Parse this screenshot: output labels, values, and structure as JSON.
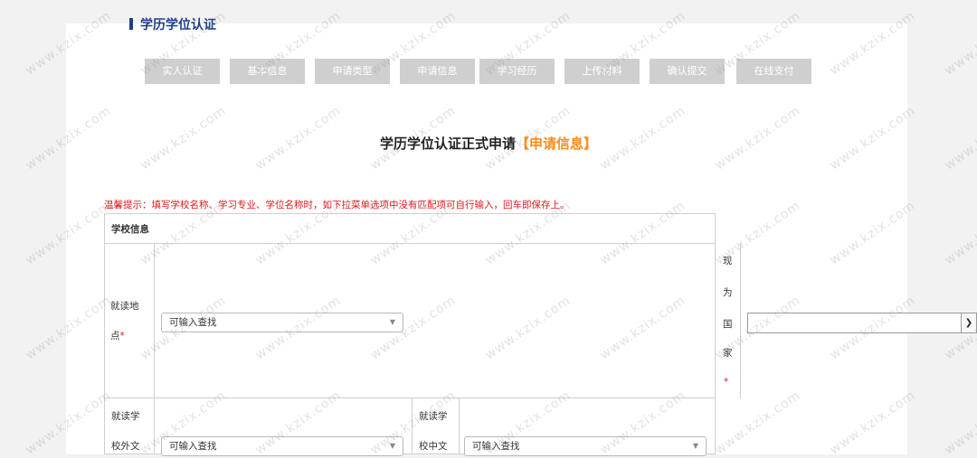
{
  "section_title": "学历学位认证",
  "steps": [
    "实人认证",
    "基本信息",
    "申请类型",
    "申请信息",
    "学习经历",
    "上传材料",
    "确认提交",
    "在线支付"
  ],
  "heading": {
    "main": "学历学位认证正式申请",
    "highlight": "【申请信息】"
  },
  "notice": "温馨提示：填写学校名称、学习专业、学位名称时，如下拉菜单选项中没有匹配项可自行输入，回车即保存上。",
  "form": {
    "section_header": "学校信息",
    "location": {
      "label_line1": "就读地",
      "label_line2": "点",
      "required": "*",
      "placeholder": "可输入查找"
    },
    "country": {
      "label_chars": [
        "现",
        "为",
        "国",
        "家"
      ],
      "required": "*",
      "value": ""
    },
    "school_foreign": {
      "label_line1": "就读学",
      "label_line2": "校外文",
      "placeholder": "可输入查找"
    },
    "school_chinese": {
      "label_line1": "就读学",
      "label_line2": "校中文",
      "placeholder": "可输入查找"
    }
  },
  "watermark_text": "www.kzix.com"
}
